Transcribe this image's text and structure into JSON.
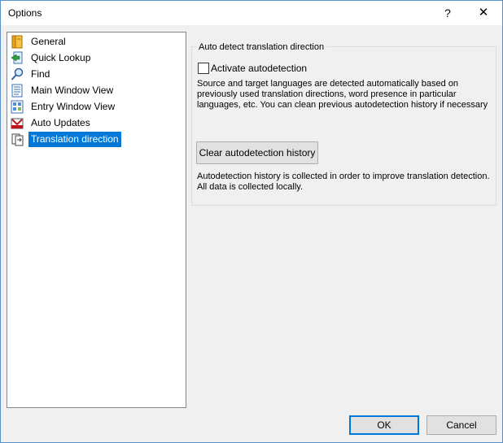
{
  "window": {
    "title": "Options",
    "help_glyph": "?",
    "close_glyph": "✕"
  },
  "tree": {
    "items": [
      {
        "label": "General",
        "icon": "general-icon"
      },
      {
        "label": "Quick Lookup",
        "icon": "quick-lookup-icon"
      },
      {
        "label": "Find",
        "icon": "find-icon"
      },
      {
        "label": "Main Window View",
        "icon": "main-window-view-icon"
      },
      {
        "label": "Entry Window View",
        "icon": "entry-window-view-icon"
      },
      {
        "label": "Auto Updates",
        "icon": "auto-updates-icon"
      },
      {
        "label": "Translation direction",
        "icon": "translation-direction-icon"
      }
    ],
    "selected": "Translation direction"
  },
  "panel": {
    "group_title": "Auto detect translation direction",
    "checkbox_label": "Activate autodetection",
    "checkbox_checked": false,
    "description_lines": [
      "Source and target languages are detected automatically based on",
      "previously used translation directions, word presence in particular",
      "languages, etc. You can clean previous autodetection history if necessary"
    ],
    "clear_button": "Clear autodetection history",
    "note_lines": [
      "Autodetection history is collected in order to improve translation detection.",
      "All data is collected locally."
    ]
  },
  "buttons": {
    "ok": "OK",
    "cancel": "Cancel"
  },
  "colors": {
    "selection": "#0078d7",
    "window_border": "#5a8fc7",
    "background": "#f0f0f0"
  }
}
